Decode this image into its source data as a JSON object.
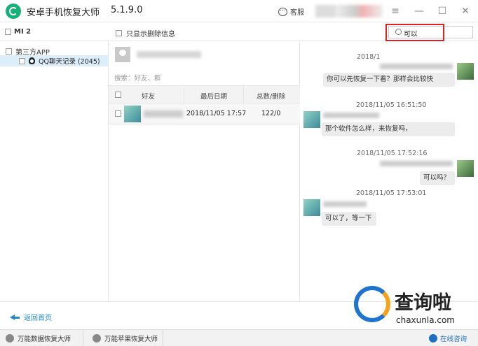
{
  "window": {
    "title": "安卓手机恢复大师",
    "version": "5.1.9.0",
    "support_label": "客服"
  },
  "toolbar": {
    "device": "MI 2",
    "only_deleted_label": "只显示删除信息",
    "search_value": "可以"
  },
  "sidebar": {
    "root_label": "第三方APP",
    "item_label": "QQ聊天记录 (2045)"
  },
  "contacts": {
    "filter_placeholder": "搜索：好友、群",
    "columns": [
      "好友",
      "最后日期",
      "总数/删除"
    ],
    "rows": [
      {
        "date": "2018/11/05 17:57",
        "count": "122/0"
      }
    ]
  },
  "chat": {
    "messages": [
      {
        "side": "right",
        "time": "2018/1",
        "text": "你可以先恢复一下看？那样会比较快"
      },
      {
        "side": "left",
        "time": "2018/11/05 16:51:50",
        "text": "那个软件怎么样，来恢复吗，"
      },
      {
        "side": "right",
        "time": "2018/11/05 17:52:16",
        "text": "可以吗？"
      },
      {
        "side": "left",
        "time": "2018/11/05 17:53:01",
        "text": "可以了，等一下"
      }
    ]
  },
  "footer": {
    "back_label": "返回首页"
  },
  "watermark": {
    "text": "查询啦",
    "sub": "chaxunla.com"
  },
  "statusbar": {
    "item1": "万能数据恢复大师",
    "item2": "万能苹果恢复大师",
    "online": "在线咨询"
  }
}
